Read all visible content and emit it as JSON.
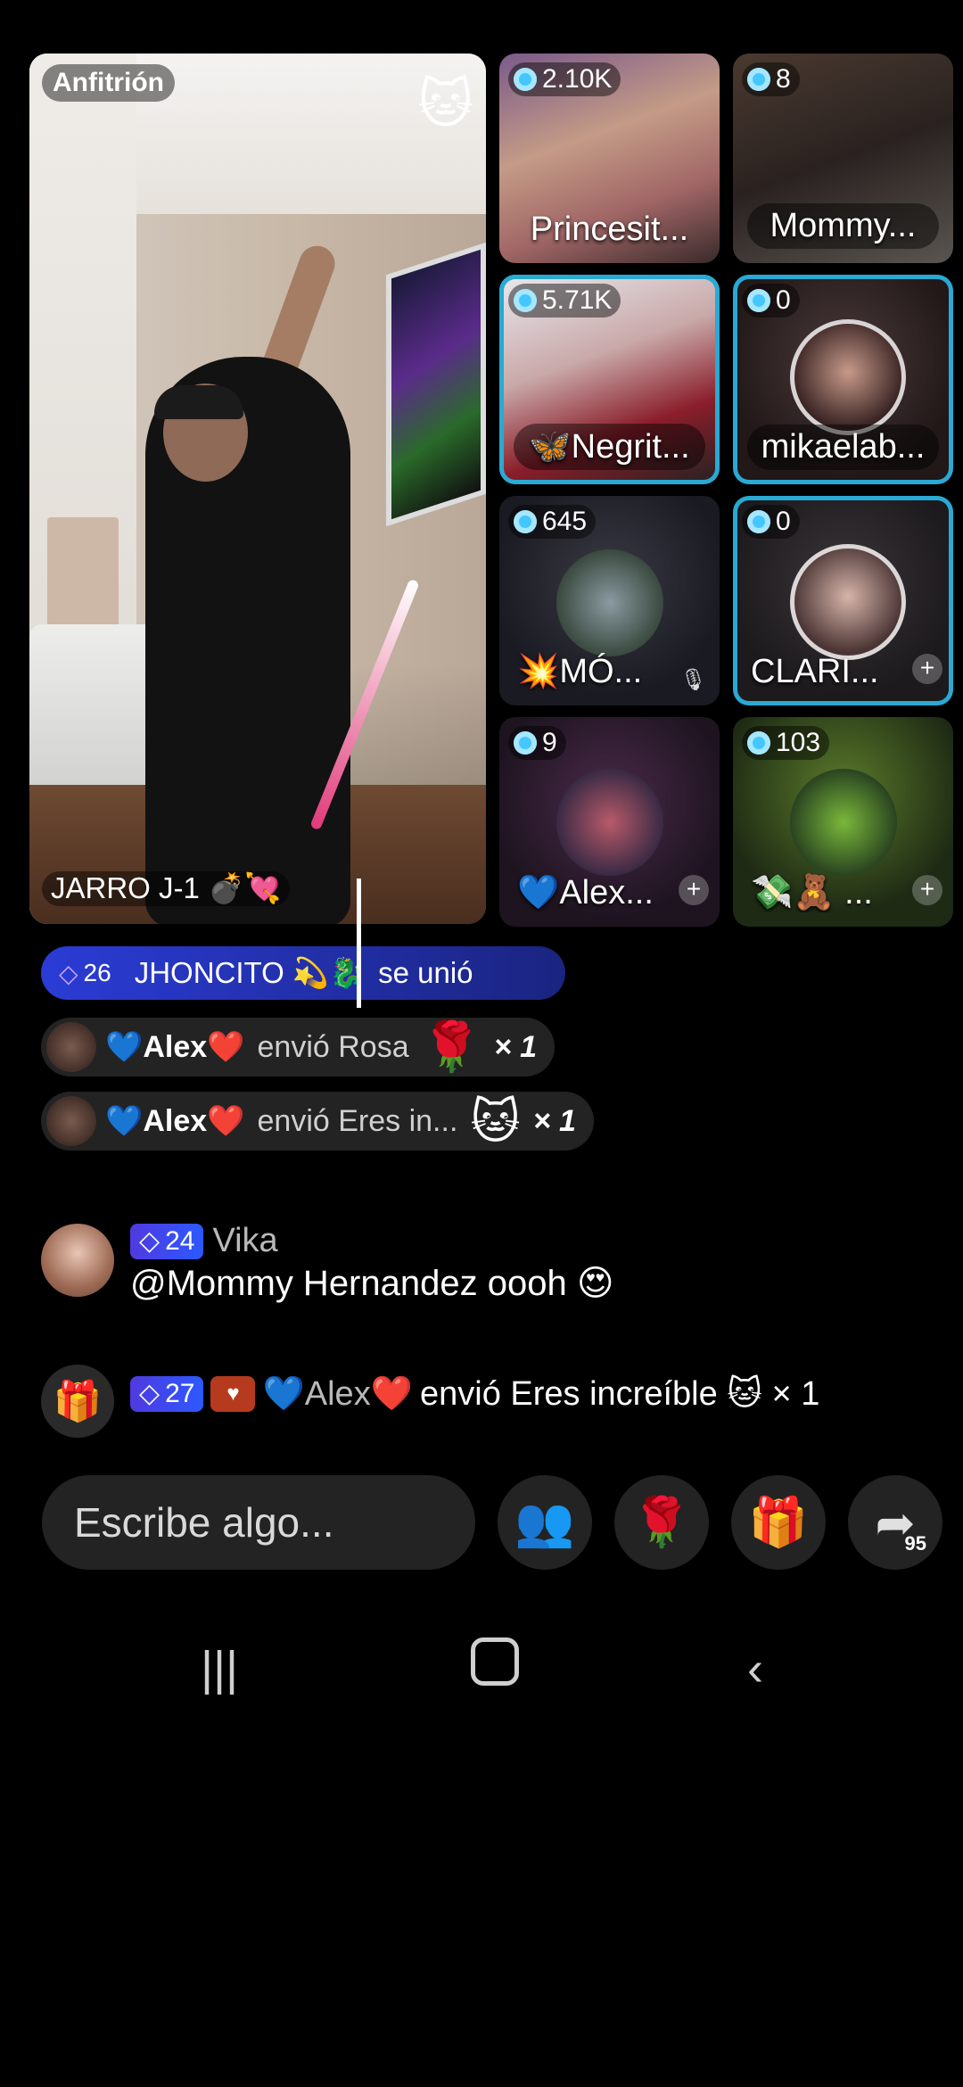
{
  "host": {
    "label": "Anfitrión",
    "name": "JARRO J-1 💣💘",
    "pet_icon": "cat-waving-icon"
  },
  "guests": [
    {
      "count": "2.10K",
      "name": "Princesit...",
      "selected": false,
      "plus": false
    },
    {
      "count": "8",
      "name": "Mommy...",
      "selected": false,
      "plus": false
    },
    {
      "count": "5.71K",
      "name": "🦋Negrit...",
      "selected": true,
      "plus": false
    },
    {
      "count": "0",
      "name": "mikaelab...",
      "selected": true,
      "plus": false
    },
    {
      "count": "645",
      "name": "💥MÓ...",
      "selected": false,
      "plus": false,
      "muted": true
    },
    {
      "count": "0",
      "name": "CLARI...",
      "selected": true,
      "plus": true
    },
    {
      "count": "9",
      "name": "💙Alex...",
      "selected": false,
      "plus": true
    },
    {
      "count": "103",
      "name": "💸🧸 ...",
      "selected": false,
      "plus": true
    }
  ],
  "feed": {
    "join": {
      "level": "26",
      "user": "JHONCITO 💫🐉",
      "action": "se unió"
    },
    "gifts": [
      {
        "user": "💙Alex❤️",
        "action": "envió Rosa",
        "gift": "🌹",
        "count": "× 1"
      },
      {
        "user": "💙Alex❤️",
        "action": "envió Eres in...",
        "gift": "🐱",
        "count": "× 1"
      }
    ],
    "comment": {
      "level": "24",
      "user": "Vika",
      "text": "@Mommy  Hernandez oooh 😍"
    },
    "system": {
      "level": "27",
      "user": "💙Alex❤️",
      "text": "envió Eres increíble 🐱 × 1"
    }
  },
  "input": {
    "placeholder": "Escribe algo..."
  },
  "actions": {
    "share_count": "95"
  },
  "colors": {
    "selected_border": "#29a9d4",
    "join_banner": "#2b3cd6",
    "level_badge": "#4f3ae0"
  }
}
